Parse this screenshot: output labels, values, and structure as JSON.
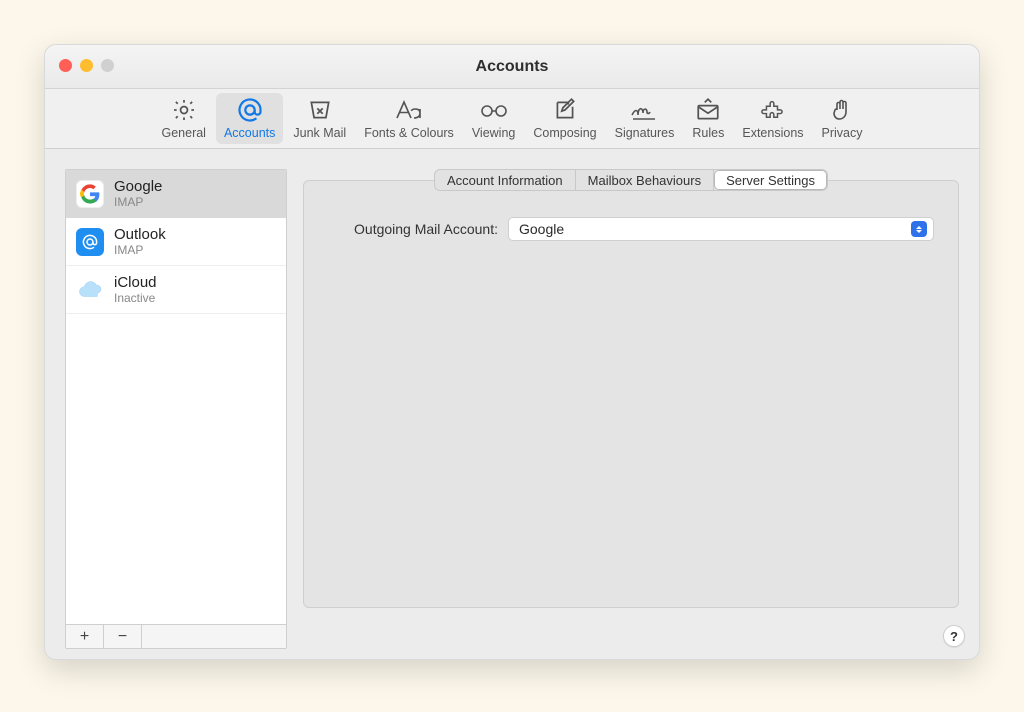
{
  "window": {
    "title": "Accounts"
  },
  "toolbar": {
    "items": [
      {
        "id": "general",
        "label": "General"
      },
      {
        "id": "accounts",
        "label": "Accounts"
      },
      {
        "id": "junk",
        "label": "Junk Mail"
      },
      {
        "id": "fonts",
        "label": "Fonts & Colours"
      },
      {
        "id": "viewing",
        "label": "Viewing"
      },
      {
        "id": "composing",
        "label": "Composing"
      },
      {
        "id": "signatures",
        "label": "Signatures"
      },
      {
        "id": "rules",
        "label": "Rules"
      },
      {
        "id": "extensions",
        "label": "Extensions"
      },
      {
        "id": "privacy",
        "label": "Privacy"
      }
    ],
    "active_index": 1
  },
  "sidebar": {
    "accounts": [
      {
        "name": "Google",
        "subtitle": "IMAP",
        "icon": "google"
      },
      {
        "name": "Outlook",
        "subtitle": "IMAP",
        "icon": "outlook"
      },
      {
        "name": "iCloud",
        "subtitle": "Inactive",
        "icon": "icloud"
      }
    ],
    "selected_index": 0,
    "buttons": {
      "add": "+",
      "remove": "−"
    }
  },
  "tabs": {
    "items": [
      "Account Information",
      "Mailbox Behaviours",
      "Server Settings"
    ],
    "active_index": 2
  },
  "server_settings": {
    "outgoing_label": "Outgoing Mail Account:",
    "outgoing_value": "Google"
  },
  "help": "?"
}
